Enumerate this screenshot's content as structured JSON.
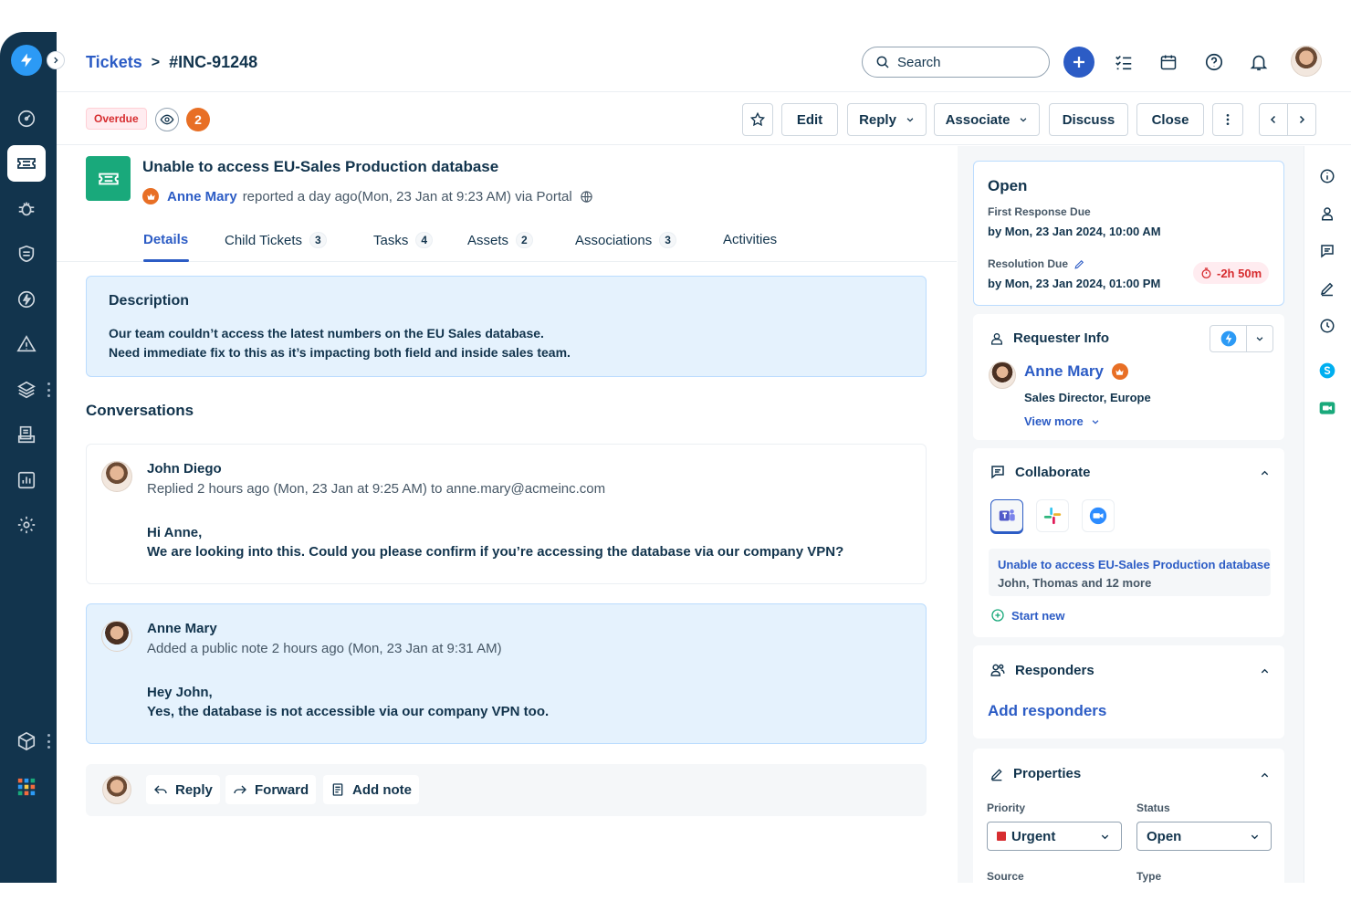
{
  "colors": {
    "brand_dark": "#12344d",
    "primary": "#2c5cc5",
    "danger": "#d72d30",
    "orange": "#e86f25",
    "green": "#19a97b"
  },
  "rail": {
    "icons": [
      "logo-bolt-icon",
      "dashboard-icon",
      "tickets-icon",
      "bug-icon",
      "shield-icon",
      "lightning-icon",
      "alert-icon",
      "layers-icon",
      "inbox-icon",
      "reports-icon",
      "settings-icon",
      "cube-icon",
      "apps-grid-icon"
    ]
  },
  "header": {
    "breadcrumb_root": "Tickets",
    "breadcrumb_sep": ">",
    "breadcrumb_current": "#INC-91248",
    "search_placeholder": "Search"
  },
  "toolbar": {
    "overdue_label": "Overdue",
    "watchers_count": "2",
    "edit": "Edit",
    "reply": "Reply",
    "associate": "Associate",
    "discuss": "Discuss",
    "close": "Close"
  },
  "ticket": {
    "title": "Unable to access EU-Sales Production database",
    "requester": "Anne Mary",
    "meta": "reported a day ago(Mon, 23 Jan at 9:23 AM) via Portal"
  },
  "tabs": [
    {
      "label": "Details",
      "count": ""
    },
    {
      "label": "Child Tickets",
      "count": "3"
    },
    {
      "label": "Tasks",
      "count": "4"
    },
    {
      "label": "Assets",
      "count": "2"
    },
    {
      "label": "Associations",
      "count": "3"
    },
    {
      "label": "Activities",
      "count": ""
    }
  ],
  "description": {
    "heading": "Description",
    "line1": "Our team couldn’t access the latest numbers on the EU Sales database.",
    "line2": "Need immediate fix to this as it’s impacting both field and inside sales team."
  },
  "conversations_title": "Conversations",
  "conversations": [
    {
      "name": "John Diego",
      "meta": "Replied 2 hours ago (Mon, 23 Jan at 9:25 AM) to anne.mary@acmeinc.com",
      "line1": "Hi Anne,",
      "line2": "We are looking into this. Could you please confirm if you’re accessing the database via our company VPN?"
    },
    {
      "name": "Anne Mary",
      "meta": "Added a public note 2 hours ago (Mon, 23 Jan at 9:31 AM)",
      "line1": "Hey John,",
      "line2": "Yes, the database is not accessible via our company VPN too."
    }
  ],
  "reply_bar": {
    "reply": "Reply",
    "forward": "Forward",
    "add_note": "Add note"
  },
  "status_card": {
    "status": "Open",
    "first_response_label": "First Response Due",
    "first_response_value": "by Mon, 23 Jan 2024, 10:00 AM",
    "resolution_label": "Resolution Due",
    "resolution_value": "by Mon, 23 Jan 2024, 01:00 PM",
    "sla_overdue": "-2h 50m"
  },
  "requester_info": {
    "heading": "Requester Info",
    "name": "Anne Mary",
    "role": "Sales Director, Europe",
    "view_more": "View more"
  },
  "collaborate": {
    "heading": "Collaborate",
    "apps": [
      "teams-icon",
      "slack-icon",
      "zoom-icon"
    ],
    "thread_title": "Unable to access EU-Sales Production database",
    "thread_people": "John, Thomas and 12 more",
    "start_new": "Start new"
  },
  "responders": {
    "heading": "Responders",
    "add": "Add responders"
  },
  "properties": {
    "heading": "Properties",
    "priority_label": "Priority",
    "priority_value": "Urgent",
    "status_label": "Status",
    "status_value": "Open",
    "source_label": "Source",
    "type_label": "Type"
  },
  "right_rail": {
    "icons": [
      "info-icon",
      "person-icon",
      "chat-icon",
      "edit-icon",
      "clock-icon",
      "skype-icon",
      "meet-icon"
    ]
  }
}
